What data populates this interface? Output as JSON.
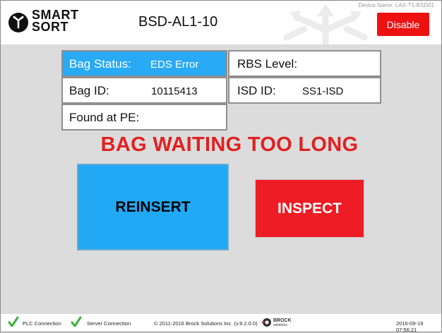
{
  "header": {
    "logo_line1": "SMART",
    "logo_line2": "SORT",
    "station": "BSD-AL1-10",
    "device_name": "Device Name: LAX-T1-BSD01",
    "disable_label": "Disable"
  },
  "info": {
    "bag_status_label": "Bag Status:",
    "bag_status_value": "EDS Error",
    "rbs_level_label": "RBS Level:",
    "rbs_level_value": "",
    "bag_id_label": "Bag ID:",
    "bag_id_value": "10115413",
    "isd_id_label": "ISD ID:",
    "isd_id_value": "SS1-ISD",
    "found_at_label": "Found at PE:",
    "found_at_value": ""
  },
  "warning": "BAG WAITING TOO LONG",
  "actions": {
    "reinsert": "REINSERT",
    "inspect": "INSPECT"
  },
  "footer": {
    "plc": "PLC Connection",
    "server": "Server Connection",
    "copyright": "© 2011-2016 Brock Solutions Inc. (v.9.2.0.0)",
    "brock_line1": "BROCK",
    "brock_line2": "solutions",
    "timestamp": "2016-09-19 07:56:21"
  },
  "colors": {
    "accent_blue": "#29aaf6",
    "alert_red": "#ee1c24",
    "ok_green": "#3bb33b"
  }
}
